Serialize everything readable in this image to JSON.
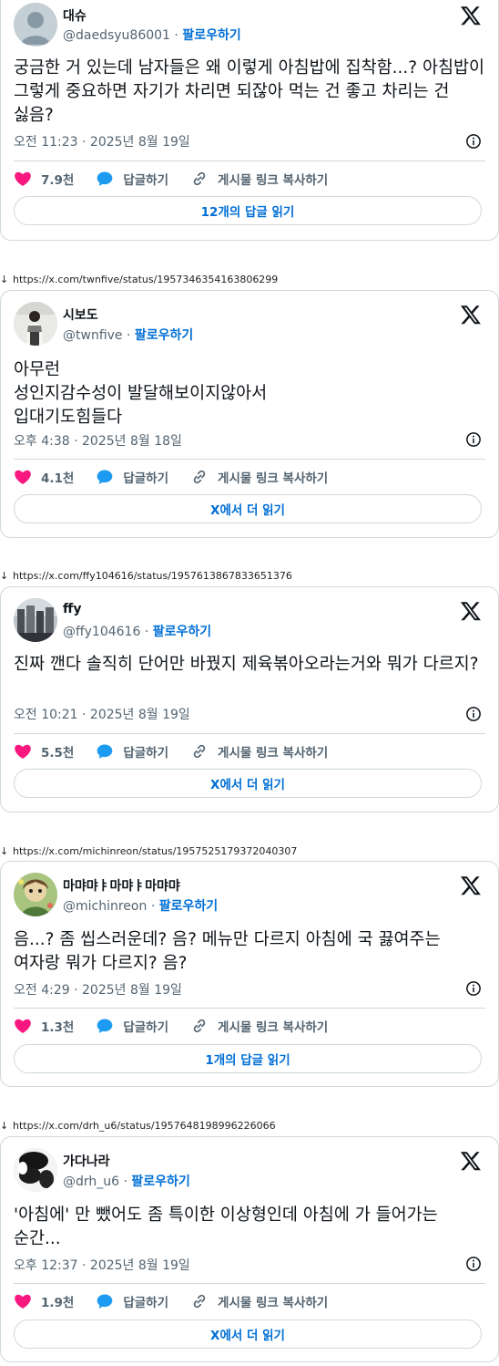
{
  "colors": {
    "link": "#006fd6",
    "heart": "#f91880",
    "reply": "#1d9bf0",
    "text": "#0f1419",
    "muted": "#536471",
    "border": "#cfd9de"
  },
  "icons": {
    "x_logo": "x-logo-icon",
    "info": "info-icon",
    "heart": "heart-icon",
    "reply": "reply-bubble-icon",
    "link": "link-icon"
  },
  "labels": {
    "follow": "팔로우하기",
    "reply": "답글하기",
    "copy_link": "게시물 링크 복사하기",
    "separator": "·"
  },
  "tweets": [
    {
      "name": "대슈",
      "handle": "@daedsyu86001",
      "text": "궁금한 거 있는데 남자들은 왜 이렇게 아침밥에 집착함...? 아침밥이 그렇게 중요하면 자기가 차리면 되잖아 먹는 건 좋고 차리는 건 싫음?",
      "time": "오전 11:23 · 2025년 8월 19일",
      "likes": "7.9천",
      "read_label": "12개의 답글 읽기"
    },
    {
      "url": "https://x.com/twnfive/status/1957346354163806299",
      "name": "시보도",
      "handle": "@twnfive",
      "text": "아무런\n성인지감수성이 발달해보이지않아서\n입대기도힘들다",
      "time": "오후 4:38 · 2025년 8월 18일",
      "likes": "4.1천",
      "read_label": "X에서 더 읽기"
    },
    {
      "url": "https://x.com/ffy104616/status/1957613867833651376",
      "name": "ffy",
      "handle": "@ffy104616",
      "text": "진짜 깬다 솔직히 단어만 바꿨지 제육볶아오라는거와 뭐가 다르지?",
      "time": "오전 10:21 · 2025년 8월 19일",
      "likes": "5.5천",
      "read_label": "X에서 더 읽기"
    },
    {
      "url": "https://x.com/michinreon/status/1957525179372040307",
      "name": "마먀먀ㅑ마먀ㅑ마먀먀",
      "handle": "@michinreon",
      "text": "음...? 좀 씹스러운데? 음? 메뉴만 다르지 아침에 국 끓여주는 여자랑 뭐가 다르지? 음?",
      "time": "오전 4:29 · 2025년 8월 19일",
      "likes": "1.3천",
      "read_label": "1개의 답글 읽기"
    },
    {
      "url": "https://x.com/drh_u6/status/1957648198996226066",
      "name": "가다나라",
      "handle": "@drh_u6",
      "text": "'아침에' 만 뺐어도 좀 특이한 이상형인데 아침에 가 들어가는 순간...",
      "time": "오후 12:37 · 2025년 8월 19일",
      "likes": "1.9천",
      "read_label": "X에서 더 읽기"
    }
  ]
}
